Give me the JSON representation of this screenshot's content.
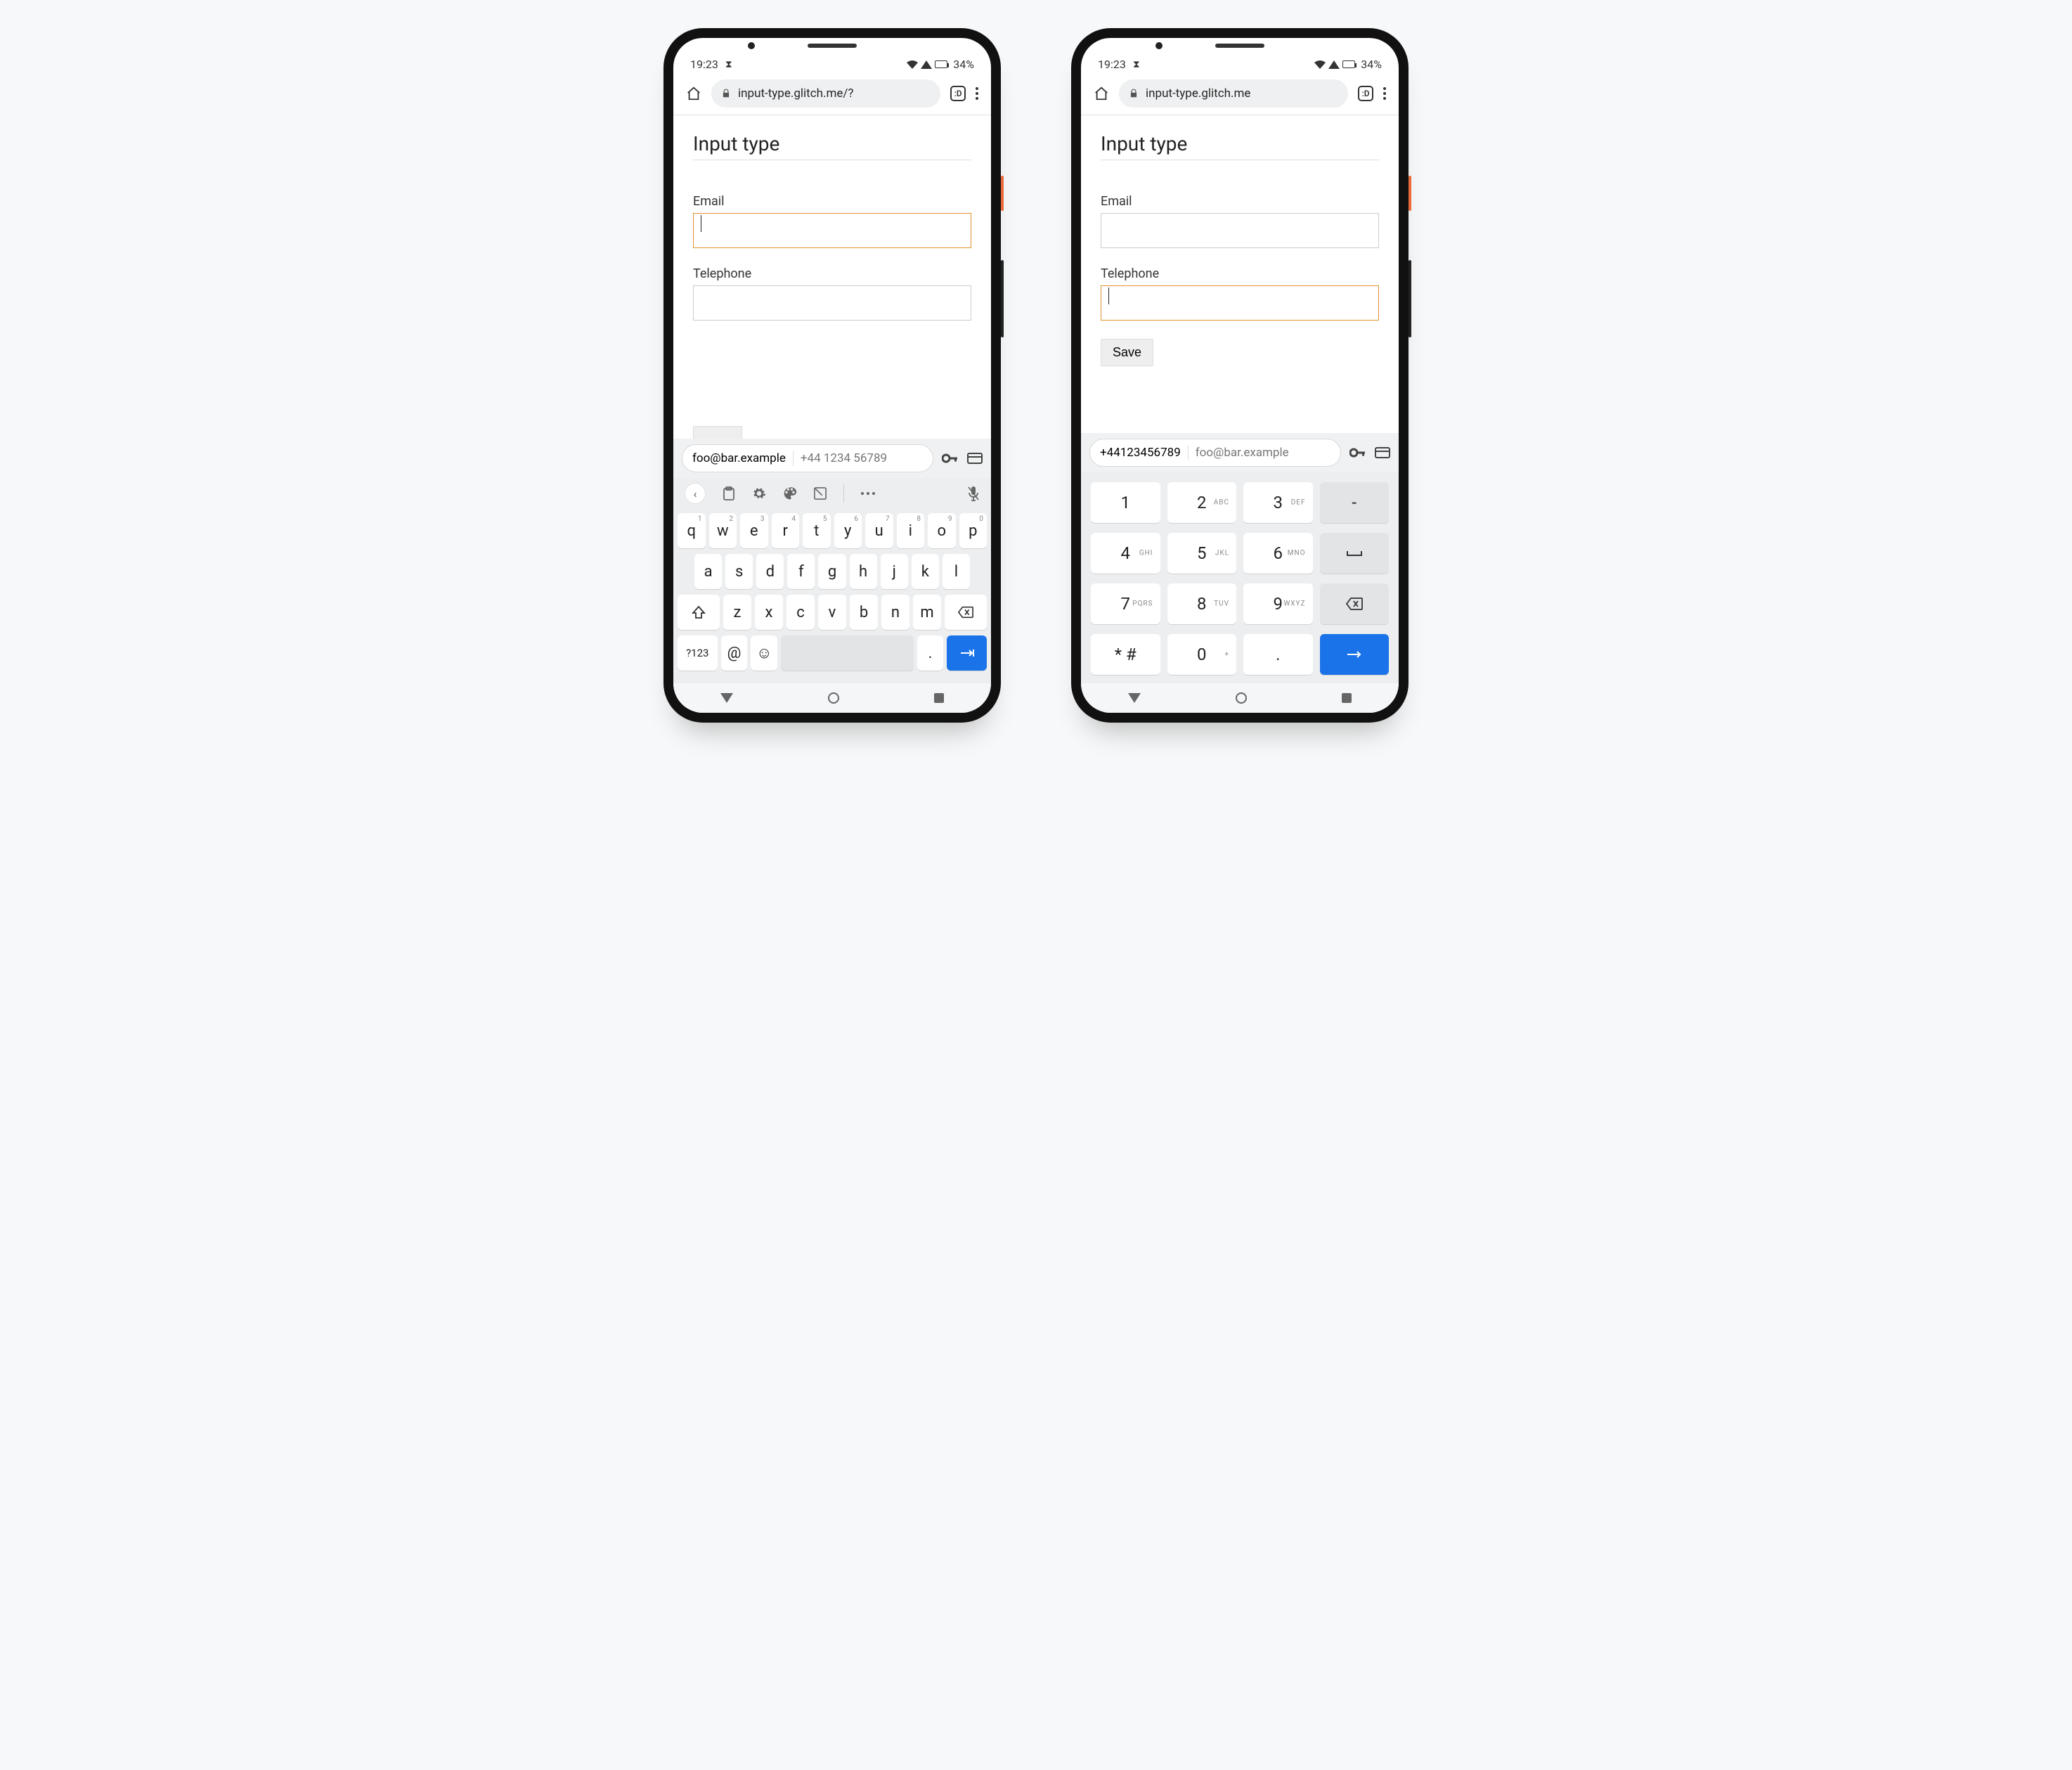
{
  "statusbar": {
    "time": "19:23",
    "battery_pct": "34%"
  },
  "chrome": {
    "url_left": "input-type.glitch.me/?",
    "url_right": "input-type.glitch.me",
    "tab_icon_label": ":D"
  },
  "page": {
    "title": "Input type",
    "email_label": "Email",
    "tel_label": "Telephone",
    "save_label": "Save"
  },
  "autofill_left": {
    "primary": "foo@bar.example",
    "secondary": "+44 1234 56789"
  },
  "autofill_right": {
    "primary": "+44123456789",
    "secondary": "foo@bar.example"
  },
  "qwerty": {
    "row1": [
      {
        "k": "q",
        "n": "1"
      },
      {
        "k": "w",
        "n": "2"
      },
      {
        "k": "e",
        "n": "3"
      },
      {
        "k": "r",
        "n": "4"
      },
      {
        "k": "t",
        "n": "5"
      },
      {
        "k": "y",
        "n": "6"
      },
      {
        "k": "u",
        "n": "7"
      },
      {
        "k": "i",
        "n": "8"
      },
      {
        "k": "o",
        "n": "9"
      },
      {
        "k": "p",
        "n": "0"
      }
    ],
    "row2": [
      "a",
      "s",
      "d",
      "f",
      "g",
      "h",
      "j",
      "k",
      "l"
    ],
    "row3": [
      "z",
      "x",
      "c",
      "v",
      "b",
      "n",
      "m"
    ],
    "row4": {
      "sym": "?123",
      "at": "@",
      "period": "."
    }
  },
  "numpad": {
    "rows": [
      [
        {
          "d": "1"
        },
        {
          "d": "2",
          "s": "ABC"
        },
        {
          "d": "3",
          "s": "DEF"
        },
        {
          "op": "-"
        }
      ],
      [
        {
          "d": "4",
          "s": "GHI"
        },
        {
          "d": "5",
          "s": "JKL"
        },
        {
          "d": "6",
          "s": "MNO"
        },
        {
          "op": "␣"
        }
      ],
      [
        {
          "d": "7",
          "s": "PQRS"
        },
        {
          "d": "8",
          "s": "TUV"
        },
        {
          "d": "9",
          "s": "WXYZ"
        },
        {
          "op": "bksp"
        }
      ],
      [
        {
          "d": "* #"
        },
        {
          "d": "0",
          "s": "+"
        },
        {
          "d": "."
        },
        {
          "op": "enter"
        }
      ]
    ]
  }
}
